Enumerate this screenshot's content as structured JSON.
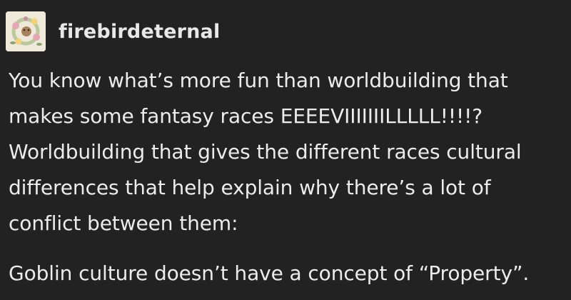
{
  "post": {
    "author": "firebirdeternal",
    "avatar_icon": "flower-wreath-icon",
    "paragraphs": [
      {
        "lines": [
          "You know what’s more fun than worldbuilding that",
          "makes some fantasy races EEEEVIIIIIIILLLLL!!!!?",
          "Worldbuilding that gives the different races cultural",
          "differences that help explain why there’s a lot of",
          "conflict between them:"
        ]
      },
      {
        "lines": [
          "Goblin culture doesn’t have a concept of “Property”."
        ]
      }
    ]
  },
  "colors": {
    "background": "#222222",
    "text": "#ececec",
    "avatar_bg": "#efe9da"
  }
}
